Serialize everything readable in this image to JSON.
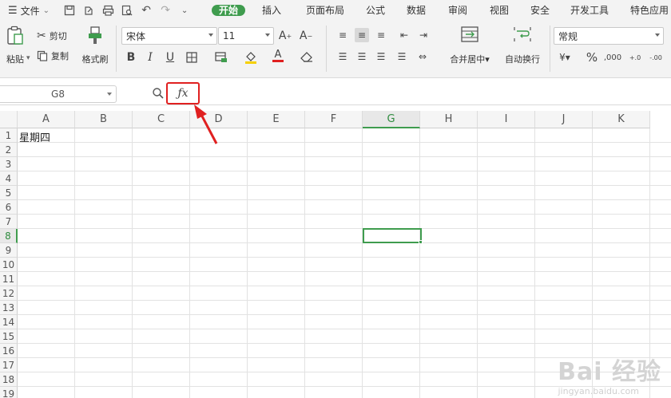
{
  "menubar": {
    "file_label": "文件",
    "tabs": [
      "开始",
      "插入",
      "页面布局",
      "公式",
      "数据",
      "审阅",
      "视图",
      "安全",
      "开发工具",
      "特色应用"
    ],
    "active_tab": "开始"
  },
  "ribbon": {
    "paste_label": "粘贴",
    "cut_label": "剪切",
    "copy_label": "复制",
    "format_painter_label": "格式刷",
    "font_name": "宋体",
    "font_size": "11",
    "merge_center_label": "合并居中",
    "wrap_text_label": "自动换行",
    "number_format": "常规"
  },
  "formula_bar": {
    "name_box": "G8",
    "fx_label": "ƒx",
    "content": ""
  },
  "sheet": {
    "columns": [
      "A",
      "B",
      "C",
      "D",
      "E",
      "F",
      "G",
      "H",
      "I",
      "J",
      "K"
    ],
    "rows": [
      "1",
      "2",
      "3",
      "4",
      "5",
      "6",
      "7",
      "8",
      "9",
      "10",
      "11",
      "12",
      "13",
      "14",
      "15",
      "16",
      "17",
      "18",
      "19"
    ],
    "selected_column": "G",
    "selected_row": "8",
    "cell_a1": "星期四"
  },
  "watermark": {
    "text": "Bai 经验",
    "sub": "jingyan.baidu.com"
  },
  "colors": {
    "accent": "#3f9c4e",
    "highlight": "#e02020"
  }
}
